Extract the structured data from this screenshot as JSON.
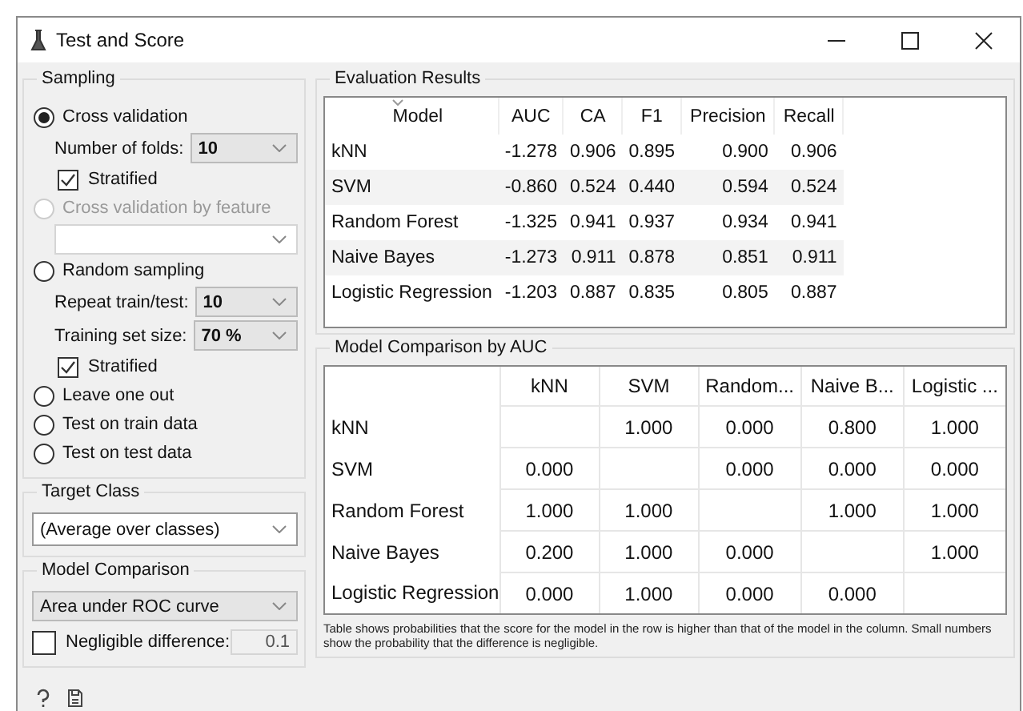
{
  "window": {
    "title": "Test and Score"
  },
  "sampling": {
    "title": "Sampling",
    "controls": [
      {
        "kind": "radio",
        "label": "Cross validation",
        "selected": true,
        "disabled": false
      },
      {
        "kind": "dropdown",
        "label": "Number of folds:",
        "value": "10",
        "disabled": false
      },
      {
        "kind": "checkbox",
        "label": "Stratified",
        "checked": true
      },
      {
        "kind": "radio",
        "label": "Cross validation by feature",
        "selected": false,
        "disabled": true
      },
      {
        "kind": "dropdown",
        "disabled": true
      },
      {
        "kind": "radio",
        "label": "Random sampling",
        "selected": false,
        "disabled": false
      },
      {
        "kind": "dropdown",
        "label": "Repeat train/test:",
        "value": "10",
        "disabled": false
      },
      {
        "kind": "dropdown",
        "label": "Training set size:",
        "value": "70 %",
        "disabled": false
      },
      {
        "kind": "checkbox",
        "label": "Stratified",
        "checked": true
      },
      {
        "kind": "radio",
        "label": "Leave one out",
        "selected": false,
        "disabled": false
      },
      {
        "kind": "radio",
        "label": "Test on train data",
        "selected": false,
        "disabled": false
      },
      {
        "kind": "radio",
        "label": "Test on test data",
        "selected": false,
        "disabled": false
      }
    ]
  },
  "target_class": {
    "title": "Target Class",
    "value": "(Average over classes)"
  },
  "model_comparison": {
    "title": "Model Comparison",
    "value": "Area under ROC curve",
    "negligible": {
      "label": "Negligible difference:",
      "checked": false,
      "value": "0.1"
    }
  },
  "evaluation": {
    "title": "Evaluation Results",
    "columns": [
      "Model",
      "AUC",
      "CA",
      "F1",
      "Precision",
      "Recall"
    ],
    "rows": [
      [
        "kNN",
        "-1.278",
        "0.906",
        "0.895",
        "0.900",
        "0.906"
      ],
      [
        "SVM",
        "-0.860",
        "0.524",
        "0.440",
        "0.594",
        "0.524"
      ],
      [
        "Random Forest",
        "-1.325",
        "0.941",
        "0.937",
        "0.934",
        "0.941"
      ],
      [
        "Naive Bayes",
        "-1.273",
        "0.911",
        "0.878",
        "0.851",
        "0.911"
      ],
      [
        "Logistic Regression",
        "-1.203",
        "0.887",
        "0.835",
        "0.805",
        "0.887"
      ]
    ]
  },
  "comparison": {
    "title": "Model Comparison by AUC",
    "columns": [
      "kNN",
      "SVM",
      "Random...",
      "Naive B...",
      "Logistic ..."
    ],
    "rows": [
      {
        "label": "kNN",
        "cells": [
          null,
          "1.000",
          "0.000",
          "0.800",
          "1.000"
        ]
      },
      {
        "label": "SVM",
        "cells": [
          "0.000",
          null,
          "0.000",
          "0.000",
          "0.000"
        ]
      },
      {
        "label": "Random Forest",
        "cells": [
          "1.000",
          "1.000",
          null,
          "1.000",
          "1.000"
        ]
      },
      {
        "label": "Naive Bayes",
        "cells": [
          "0.200",
          "1.000",
          "0.000",
          null,
          "1.000"
        ]
      },
      {
        "label": "Logistic Regression",
        "cells": [
          "0.000",
          "1.000",
          "0.000",
          "0.000",
          null
        ]
      }
    ],
    "note": "Table shows probabilities that the score for the model in the row is higher than that of the model in the column. Small numbers show the probability that the difference is negligible."
  }
}
